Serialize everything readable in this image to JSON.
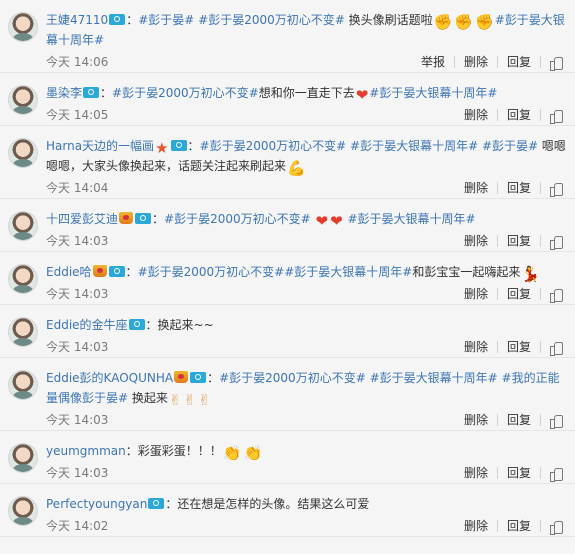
{
  "actions": {
    "report": "举报",
    "delete": "删除",
    "reply": "回复"
  },
  "comments": [
    {
      "user": "王婕47110",
      "segments": [
        {
          "t": "text",
          "v": "："
        },
        {
          "t": "tag",
          "v": "#彭于晏#"
        },
        {
          "t": "text",
          "v": " "
        },
        {
          "t": "tag",
          "v": "#彭于晏2000万初心不变#"
        },
        {
          "t": "text",
          "v": " 换头像刷话题啦"
        },
        {
          "t": "emoji",
          "v": "✊",
          "cls": "e-fist"
        },
        {
          "t": "emoji",
          "v": "✊",
          "cls": "e-fist"
        },
        {
          "t": "emoji",
          "v": "✊",
          "cls": "e-fist"
        },
        {
          "t": "tag",
          "v": "#彭于晏大银幕十周年#"
        }
      ],
      "badges": [
        "verify"
      ],
      "time": "今天 14:06",
      "report": true
    },
    {
      "user": "墨染李",
      "segments": [
        {
          "t": "text",
          "v": "："
        },
        {
          "t": "tag",
          "v": "#彭于晏2000万初心不变#"
        },
        {
          "t": "text",
          "v": "想和你一直走下去"
        },
        {
          "t": "emoji",
          "v": "❤",
          "cls": "e-heart"
        },
        {
          "t": "tag",
          "v": "#彭于晏大银幕十周年#"
        }
      ],
      "badges": [
        "verify"
      ],
      "time": "今天 14:05",
      "report": false
    },
    {
      "user": "Harna天边的一幅画",
      "segments": [
        {
          "t": "text",
          "v": "："
        },
        {
          "t": "tag",
          "v": "#彭于晏2000万初心不变#"
        },
        {
          "t": "text",
          "v": " "
        },
        {
          "t": "tag",
          "v": "#彭于晏大银幕十周年#"
        },
        {
          "t": "text",
          "v": " "
        },
        {
          "t": "tag",
          "v": "#彭于晏#"
        },
        {
          "t": "text",
          "v": " 嗯嗯嗯嗯，大家头像换起来，话题关注起来刷起来"
        },
        {
          "t": "emoji",
          "v": "💪",
          "cls": "e-fist"
        }
      ],
      "badges": [
        "star",
        "verify"
      ],
      "time": "今天 14:04",
      "report": false
    },
    {
      "user": "十四爱彭艾迪",
      "segments": [
        {
          "t": "text",
          "v": "："
        },
        {
          "t": "tag",
          "v": "#彭于晏2000万初心不变#"
        },
        {
          "t": "text",
          "v": " "
        },
        {
          "t": "emoji",
          "v": "❤",
          "cls": "e-heart"
        },
        {
          "t": "emoji",
          "v": "❤",
          "cls": "e-heart"
        },
        {
          "t": "text",
          "v": " "
        },
        {
          "t": "tag",
          "v": "#彭于晏大银幕十周年#"
        }
      ],
      "badges": [
        "crown",
        "verify"
      ],
      "time": "今天 14:03",
      "report": false
    },
    {
      "user": "Eddie哈",
      "segments": [
        {
          "t": "text",
          "v": "："
        },
        {
          "t": "tag",
          "v": "#彭于晏2000万初心不变##彭于晏大银幕十周年#"
        },
        {
          "t": "text",
          "v": "和彭宝宝一起嗨起来"
        },
        {
          "t": "emoji",
          "v": "💃",
          "cls": "e-dancer"
        }
      ],
      "badges": [
        "crown",
        "verify"
      ],
      "time": "今天 14:03",
      "report": false
    },
    {
      "user": "Eddie的金牛座",
      "segments": [
        {
          "t": "text",
          "v": "：换起来~~"
        }
      ],
      "badges": [
        "verify"
      ],
      "time": "今天 14:03",
      "report": false
    },
    {
      "user": "Eddie彭的KAOQUNHA",
      "segments": [
        {
          "t": "text",
          "v": "："
        },
        {
          "t": "tag",
          "v": "#彭于晏2000万初心不变#"
        },
        {
          "t": "text",
          "v": " "
        },
        {
          "t": "tag",
          "v": "#彭于晏大银幕十周年#"
        },
        {
          "t": "text",
          "v": " "
        },
        {
          "t": "tag",
          "v": "#我的正能量偶像彭于晏#"
        },
        {
          "t": "text",
          "v": " 换起来"
        },
        {
          "t": "emoji",
          "v": "✌",
          "cls": "e-vee"
        },
        {
          "t": "emoji",
          "v": "✌",
          "cls": "e-vee"
        },
        {
          "t": "emoji",
          "v": "✌",
          "cls": "e-vee"
        }
      ],
      "badges": [
        "crown",
        "verify"
      ],
      "time": "今天 14:03",
      "report": false
    },
    {
      "user": "yeumgmman",
      "segments": [
        {
          "t": "text",
          "v": "：彩蛋彩蛋！！！"
        },
        {
          "t": "emoji",
          "v": "👏",
          "cls": "e-clap"
        },
        {
          "t": "emoji",
          "v": "👏",
          "cls": "e-clap"
        }
      ],
      "badges": [],
      "time": "今天 14:03",
      "report": false
    },
    {
      "user": "Perfectyoungyan",
      "segments": [
        {
          "t": "text",
          "v": "：还在想是怎样的头像。结果这么可爱"
        }
      ],
      "badges": [
        "verify"
      ],
      "time": "今天 14:02",
      "report": false
    }
  ]
}
